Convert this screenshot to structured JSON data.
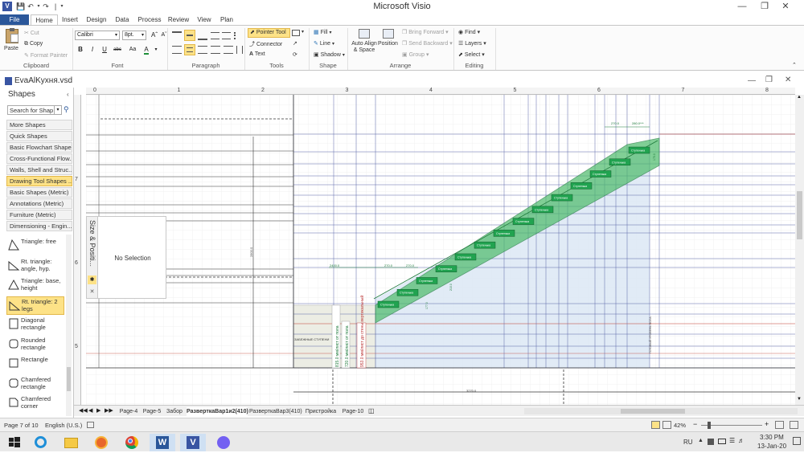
{
  "app": {
    "title": "Microsoft Visio",
    "document_title": "EvaAlKухня.vsd"
  },
  "tabs": [
    "File",
    "Home",
    "Insert",
    "Design",
    "Data",
    "Process",
    "Review",
    "View",
    "Plan"
  ],
  "ribbon": {
    "clipboard": {
      "paste": "Paste",
      "cut": "Cut",
      "copy": "Copy",
      "format_painter": "Format Painter",
      "label": "Clipboard"
    },
    "font": {
      "name": "Calibri",
      "size": "8pt.",
      "bold": "B",
      "italic": "I",
      "underline": "U",
      "strike": "abc",
      "case": "Aa",
      "color": "A",
      "label": "Font"
    },
    "paragraph": {
      "label": "Paragraph"
    },
    "tools": {
      "pointer": "Pointer Tool",
      "connector": "Connector",
      "text": "Text",
      "label": "Tools"
    },
    "shape": {
      "fill": "Fill",
      "line": "Line",
      "shadow": "Shadow",
      "label": "Shape"
    },
    "arrange": {
      "auto_align": "Auto Align & Space",
      "position": "Position",
      "bring_forward": "Bring Forward",
      "send_backward": "Send Backward",
      "group": "Group",
      "label": "Arrange"
    },
    "editing": {
      "find": "Find",
      "layers": "Layers",
      "select": "Select",
      "label": "Editing"
    }
  },
  "shapes_panel": {
    "title": "Shapes",
    "search_placeholder": "Search for Shap",
    "stencils": [
      "More Shapes",
      "Quick Shapes",
      "Basic Flowchart Shape...",
      "Cross-Functional Flow...",
      "Walls, Shell and Struc...",
      "Drawing Tool Shapes ...",
      "Basic Shapes (Metric)",
      "Annotations (Metric)",
      "Furniture (Metric)",
      "Dimensioning - Engin..."
    ],
    "active_stencil_index": 5,
    "masters": [
      "Triangle: free",
      "Rt. triangle: angle, hyp.",
      "Triangle: base, height",
      "Rt. triangle: 2 legs",
      "Diagonal rectangle",
      "Rounded rectangle",
      "Rectangle",
      "Chamfered rectangle",
      "Chamfered corner"
    ],
    "active_master_index": 3
  },
  "size_position": {
    "title": "Size & Positi...",
    "text": "No Selection"
  },
  "ruler": {
    "h_ticks": [
      "0",
      "1",
      "2",
      "3",
      "4",
      "5",
      "6",
      "7",
      "8"
    ],
    "v_ticks": [
      "7",
      "6",
      "5"
    ]
  },
  "drawing": {
    "step_label": "Ступенька",
    "landing_text": "ЗАБЕЖНЫЕ СТУПЕНИ",
    "dim_top_1": "270.0",
    "dim_top_2": "280.0***",
    "dim_mid_1": "2400.0",
    "dim_mid_2": "270.0",
    "dim_mid_3": "270.0",
    "dim_bottom": "3270.0",
    "vert_dim": "2800.0",
    "vert_label_right": "ГОТОВЫЙ УРОВЕНЬ ПОЛА",
    "vert_label_1": "815.0 мм/лист от пола",
    "vert_label_2": "720.0 мм/лист от пола",
    "vert_label_3": "953.0 мм/лист до стены вертикальный",
    "vert_small_1": "210.0",
    "vert_small_2": "177.0",
    "vert_small_3": "175.0"
  },
  "page_tabs": [
    "Page-4",
    "Page-5",
    "Забор",
    "РазверткаВар1и2(410)",
    "РазверткаВар3(410)",
    "Пристройка",
    "Page-10"
  ],
  "active_page_index": 3,
  "status": {
    "page": "Page 7 of 10",
    "language": "English (U.S.)",
    "zoom": "42%"
  },
  "taskbar": {
    "language": "RU",
    "time": "3:30 PM",
    "date": "13-Jan-20"
  },
  "colors": {
    "accent": "#2b579a",
    "step_fill": "#21a350",
    "stair_band": "#4dbb6a",
    "highlight": "#fde287",
    "blue_area": "#dce8f5"
  }
}
